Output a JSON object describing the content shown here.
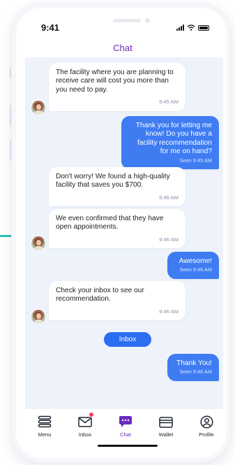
{
  "status_bar": {
    "time": "9:41"
  },
  "header": {
    "title": "Chat"
  },
  "messages": [
    {
      "dir": "in",
      "text": "The facility where you are planning to receive care will cost you more than you need to pay.",
      "meta": "9:45 AM"
    },
    {
      "dir": "out",
      "text": "Thank you for letting me know! Do you have a facility recommendation for me on hand?",
      "meta": "Seen 9:45 AM"
    },
    {
      "dir": "in",
      "text": "Don't worry! We found a high-quality facility that saves you $700.",
      "meta": "9:46 AM"
    },
    {
      "dir": "in",
      "text": "We even confirmed that they have open appointments.",
      "meta": "9:46 AM"
    },
    {
      "dir": "out",
      "text": "Awesome!",
      "meta": "Seen 9:46 AM"
    },
    {
      "dir": "in",
      "text": "Check your inbox to see our recommendation.",
      "meta": "9:46 AM"
    },
    {
      "dir": "out",
      "text": "Thank You!",
      "meta": "Seen 9:46 AM"
    }
  ],
  "inbox_button": {
    "label": "Inbox"
  },
  "tabs": [
    {
      "label": "Menu",
      "icon": "menu-icon"
    },
    {
      "label": "Inbox",
      "icon": "mail-icon"
    },
    {
      "label": "Chat",
      "icon": "chat-icon"
    },
    {
      "label": "Wallet",
      "icon": "wallet-icon"
    },
    {
      "label": "Profile",
      "icon": "profile-icon"
    }
  ],
  "colors": {
    "accent": "#6b2bbf",
    "outgoing_bubble": "#3f7cf2",
    "button": "#2b6ef0",
    "chat_background": "#edf2fb",
    "badge": "#ff3b5c"
  }
}
